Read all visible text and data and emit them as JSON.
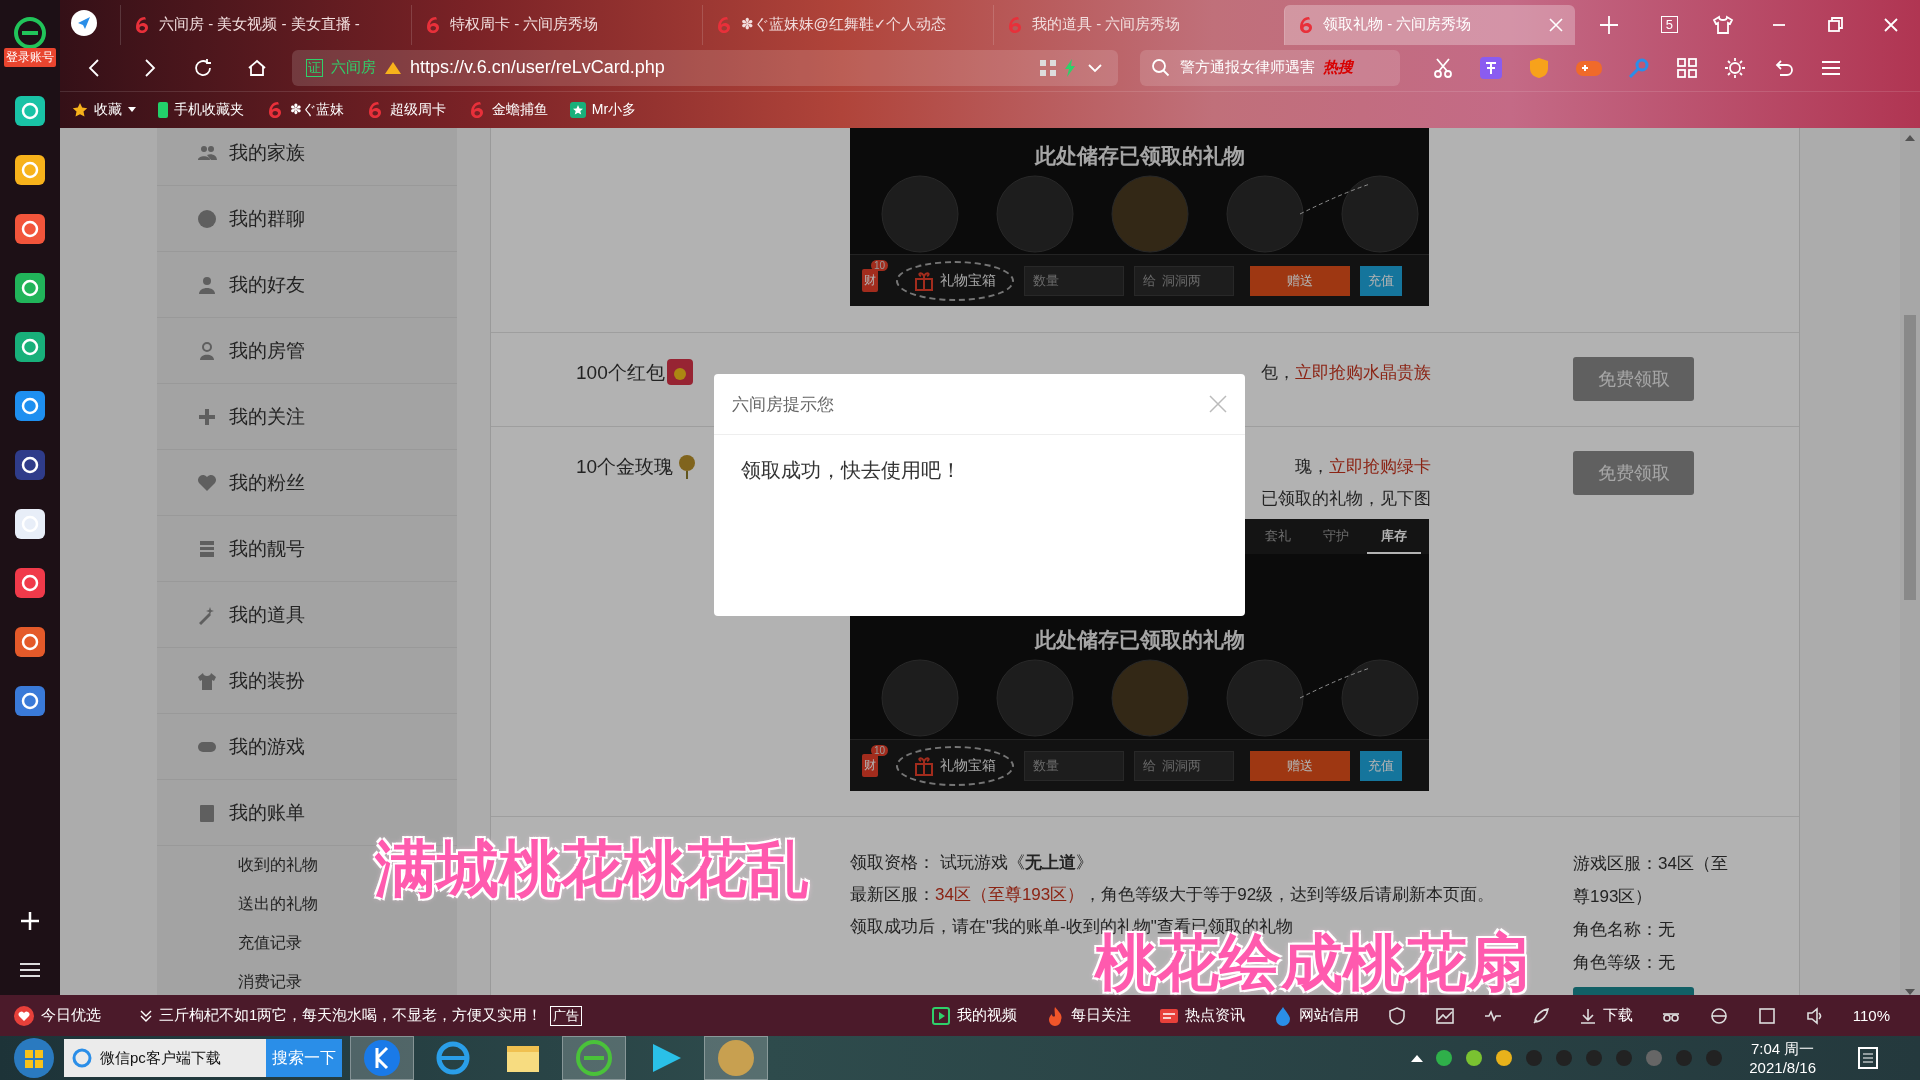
{
  "app_sidebar": {
    "login_label": "登录账号"
  },
  "browser": {
    "tabs": [
      {
        "title": "六间房 - 美女视频 - 美女直播 -",
        "selected": false
      },
      {
        "title": "特权周卡 - 六间房秀场",
        "selected": false
      },
      {
        "title": "✽ぐ蓝妹妹@红舞鞋✓个人动态",
        "selected": false
      },
      {
        "title": "我的道具 - 六间房秀场",
        "selected": false
      },
      {
        "title": "领取礼物 - 六间房秀场",
        "selected": true
      }
    ],
    "tab_count": "5",
    "address": {
      "cert_label": "证",
      "site_label": "六间房",
      "url": "https://v.6.cn/user/reLvCard.php"
    },
    "search": {
      "value": "警方通报女律师遇害",
      "hot_label": "热搜"
    }
  },
  "bookmarks": [
    {
      "label": "收藏",
      "kind": "star"
    },
    {
      "label": "手机收藏夹",
      "kind": "phone"
    },
    {
      "label": "✽ぐ蓝妹",
      "kind": "site"
    },
    {
      "label": "超级周卡",
      "kind": "site"
    },
    {
      "label": "金蟾捕鱼",
      "kind": "site"
    },
    {
      "label": "Mr小多",
      "kind": "app"
    }
  ],
  "sidebar": {
    "items": [
      {
        "label": "我的家族"
      },
      {
        "label": "我的群聊"
      },
      {
        "label": "我的好友"
      },
      {
        "label": "我的房管"
      },
      {
        "label": "我的关注"
      },
      {
        "label": "我的粉丝"
      },
      {
        "label": "我的靓号"
      },
      {
        "label": "我的道具"
      },
      {
        "label": "我的装扮"
      },
      {
        "label": "我的游戏"
      },
      {
        "label": "我的账单",
        "children": [
          {
            "label": "收到的礼物"
          },
          {
            "label": "送出的礼物"
          },
          {
            "label": "充值记录"
          },
          {
            "label": "消费记录"
          }
        ]
      }
    ]
  },
  "content": {
    "rows": [
      {
        "kind": "image_only",
        "image": {
          "caption": "此处储存已领取的礼物",
          "badge": "10",
          "wallet_label": "财",
          "box_label": "礼物宝箱",
          "quantity_label": "数量",
          "to_label": "给",
          "recipient": "洞洞两",
          "send_label": "赠送",
          "recharge_label": "充值"
        }
      },
      {
        "kind": "partial",
        "label": "100个红包",
        "lines": [
          [
            {
              "text": "包，",
              "kind": "plain"
            },
            {
              "text": "立即抢购水晶贵族",
              "kind": "link"
            }
          ]
        ],
        "button": "免费领取"
      },
      {
        "kind": "partial",
        "label": "10个金玫瑰",
        "lines": [
          [
            {
              "text": "瑰，",
              "kind": "plain"
            },
            {
              "text": "立即抢购绿卡",
              "kind": "link"
            }
          ],
          [
            {
              "text": "已领取的礼物，见下图",
              "kind": "plain"
            }
          ]
        ],
        "button": "免费领取",
        "image": {
          "tabs": [
            {
              "label": "套礼",
              "selected": false
            },
            {
              "label": "守护",
              "selected": false
            },
            {
              "label": "库存",
              "selected": true
            }
          ],
          "caption": "此处储存已领取的礼物",
          "badge": "10",
          "wallet_label": "财",
          "box_label": "礼物宝箱",
          "quantity_label": "数量",
          "to_label": "给",
          "recipient": "洞洞两",
          "send_label": "赠送",
          "recharge_label": "充值"
        }
      },
      {
        "kind": "full",
        "lines": [
          [
            {
              "text": "领取资格： 试玩游戏《**无上道**》",
              "kind": "plain"
            }
          ],
          [
            {
              "text": "最新区服：",
              "kind": "plain"
            },
            {
              "text": "34区（至尊193区）",
              "kind": "highlight"
            },
            {
              "text": "，角色等级大于等于92级，达到等级后请刷新本页面。",
              "kind": "plain"
            }
          ],
          [
            {
              "text": "领取成功后，请在\"我的账单-收到的礼物\"查看已领取的礼物",
              "kind": "plain"
            }
          ]
        ],
        "info": [
          "游戏区服：34区（至尊193区）",
          "角色名称：无",
          "角色等级：无"
        ],
        "action": true
      }
    ]
  },
  "dialog": {
    "title": "六间房提示您",
    "message": "领取成功，快去使用吧！"
  },
  "status_bar": {
    "left_label": "今日优选",
    "news": "三斤枸杞不如1两它，每天泡水喝，不显老，方便又实用！",
    "ad_label": "广告",
    "items": [
      "我的视频",
      "每日关注",
      "热点资讯",
      "网站信用"
    ],
    "download_label": "下载",
    "zoom": "110%"
  },
  "taskbar": {
    "search_value": "微信pc客户端下载",
    "search_button": "搜索一下",
    "time": "7:04 周一",
    "date": "2021/8/16"
  },
  "captions": [
    "满城桃花桃花乱",
    "桃花绘成桃花扇"
  ]
}
